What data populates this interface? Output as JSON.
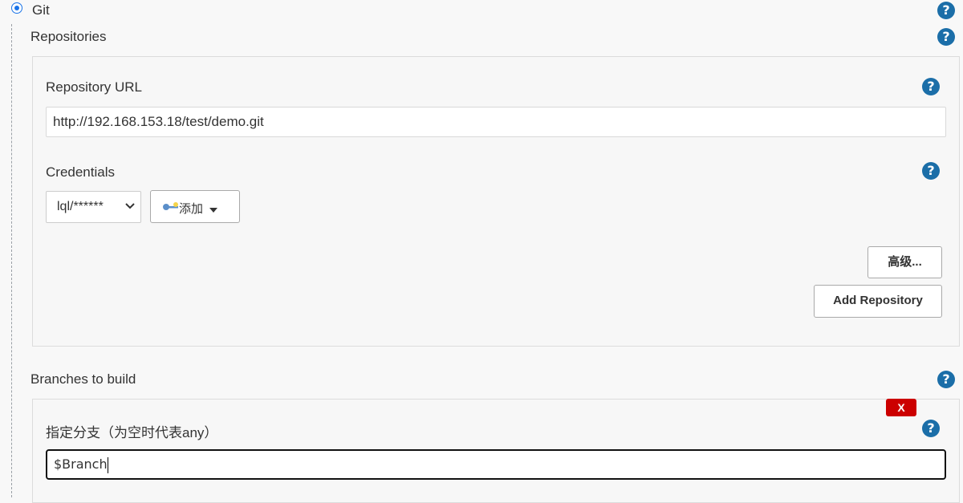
{
  "scm": {
    "git_label": "Git"
  },
  "repositories": {
    "heading": "Repositories",
    "repo_url_label": "Repository URL",
    "repo_url_value": "http://192.168.153.18/test/demo.git",
    "credentials_label": "Credentials",
    "credentials_selected": "lql/******",
    "add_label": "添加",
    "advanced_label": "高级...",
    "add_repository_label": "Add Repository"
  },
  "branches": {
    "heading": "Branches to build",
    "delete_label": "X",
    "branch_label": "指定分支（为空时代表any）",
    "branch_value": "$Branch"
  },
  "icons": {
    "help": "help-icon",
    "key": "key-icon",
    "chevron": "chevron-down-icon",
    "caret": "caret-down-icon"
  },
  "colors": {
    "help_blue": "#1b6ea8",
    "radio_blue": "#1a73e8",
    "delete_red": "#cc0000"
  }
}
